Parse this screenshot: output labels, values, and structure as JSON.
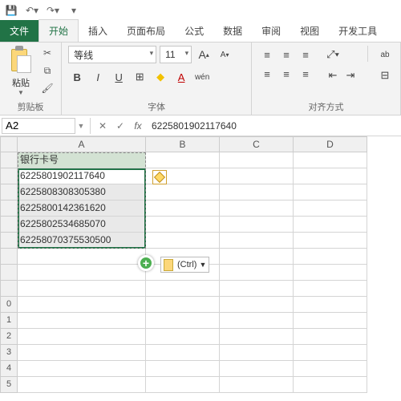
{
  "qat": {
    "save": "💾"
  },
  "tabs": {
    "file": "文件",
    "home": "开始",
    "insert": "插入",
    "layout": "页面布局",
    "formula": "公式",
    "data": "数据",
    "review": "审阅",
    "view": "视图",
    "dev": "开发工具"
  },
  "ribbon": {
    "clipboard": {
      "label": "剪贴板",
      "paste": "粘贴"
    },
    "font": {
      "label": "字体",
      "name": "等线",
      "size": "11",
      "grow": "A",
      "shrink": "A",
      "bold": "B",
      "italic": "I",
      "underline": "U",
      "border": "⊞",
      "fill": "◆",
      "color": "A",
      "wen": "wén"
    },
    "align": {
      "label": "对齐方式",
      "wrap": "ab"
    }
  },
  "namebox": "A2",
  "formula_value": "6225801902117640",
  "columns": [
    "A",
    "B",
    "C",
    "D"
  ],
  "header_cell": "银行卡号",
  "cells": [
    "6225801902117640",
    "6225808308305380",
    "6225800142361620",
    "6225802534685070",
    "62258070375530500"
  ],
  "paste_tag_label": "(Ctrl)",
  "chart_data": {
    "type": "table",
    "title": "",
    "columns": [
      "银行卡号"
    ],
    "rows": [
      [
        "6225801902117640"
      ],
      [
        "6225808308305380"
      ],
      [
        "6225800142361620"
      ],
      [
        "6225802534685070"
      ],
      [
        "62258070375530500"
      ]
    ]
  }
}
